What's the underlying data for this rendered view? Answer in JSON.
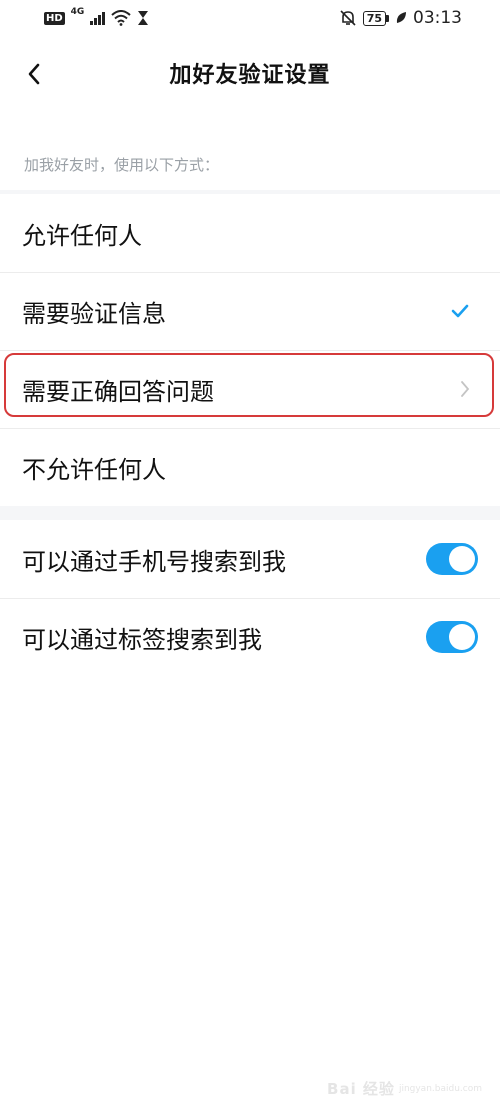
{
  "status_bar": {
    "hd": "HD",
    "network": "4G",
    "battery": "75",
    "time": "03:13"
  },
  "nav": {
    "title": "加好友验证设置"
  },
  "section_header": "加我好友时，使用以下方式：",
  "options": [
    {
      "label": "允许任何人",
      "selected": false
    },
    {
      "label": "需要验证信息",
      "selected": true
    },
    {
      "label": "需要正确回答问题",
      "selected": false
    },
    {
      "label": "不允许任何人",
      "selected": false
    }
  ],
  "toggles": [
    {
      "label": "可以通过手机号搜索到我",
      "on": true
    },
    {
      "label": "可以通过标签搜索到我",
      "on": true
    }
  ],
  "colors": {
    "accent": "#1aa0f0",
    "highlight": "#d63a3a",
    "secondary_text": "#9aa0a6"
  },
  "watermark": {
    "text": "Bai 经验",
    "sub": "jingyan.baidu.com"
  }
}
